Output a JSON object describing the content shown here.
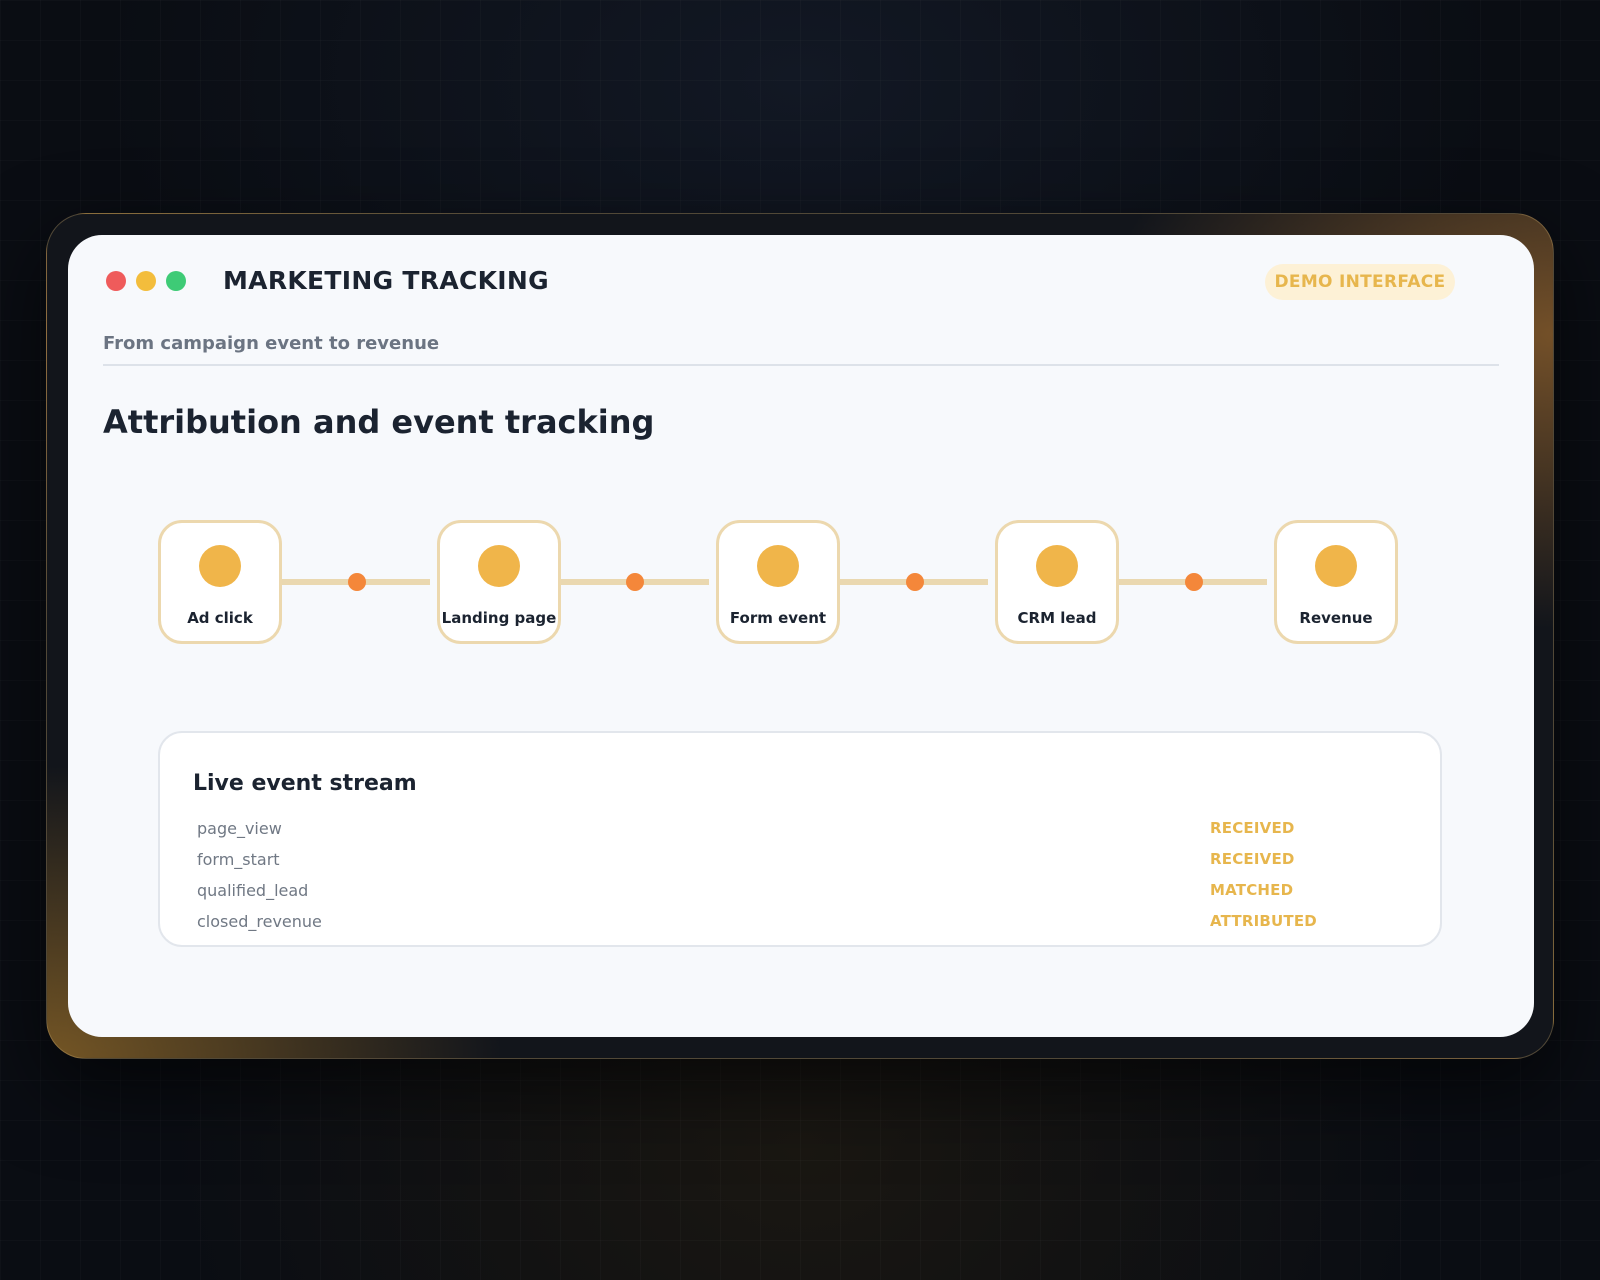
{
  "window": {
    "title": "MARKETING TRACKING",
    "badge": "DEMO INTERFACE",
    "subtitle": "From campaign event to revenue"
  },
  "page": {
    "title": "Attribution and event tracking"
  },
  "pipeline": {
    "stages": [
      {
        "label": "Ad click"
      },
      {
        "label": "Landing page"
      },
      {
        "label": "Form event"
      },
      {
        "label": "CRM lead"
      },
      {
        "label": "Revenue"
      }
    ]
  },
  "stream": {
    "title": "Live event stream",
    "events": [
      {
        "name": "page_view",
        "status": "RECEIVED"
      },
      {
        "name": "form_start",
        "status": "RECEIVED"
      },
      {
        "name": "qualified_lead",
        "status": "MATCHED"
      },
      {
        "name": "closed_revenue",
        "status": "ATTRIBUTED"
      }
    ]
  },
  "colors": {
    "accent": "#f0b54a",
    "connector_dot": "#f4873a",
    "status": "#e7b64d",
    "close": "#ef5b5b",
    "minimize": "#f3bd3c",
    "maximize": "#3ecb76"
  }
}
